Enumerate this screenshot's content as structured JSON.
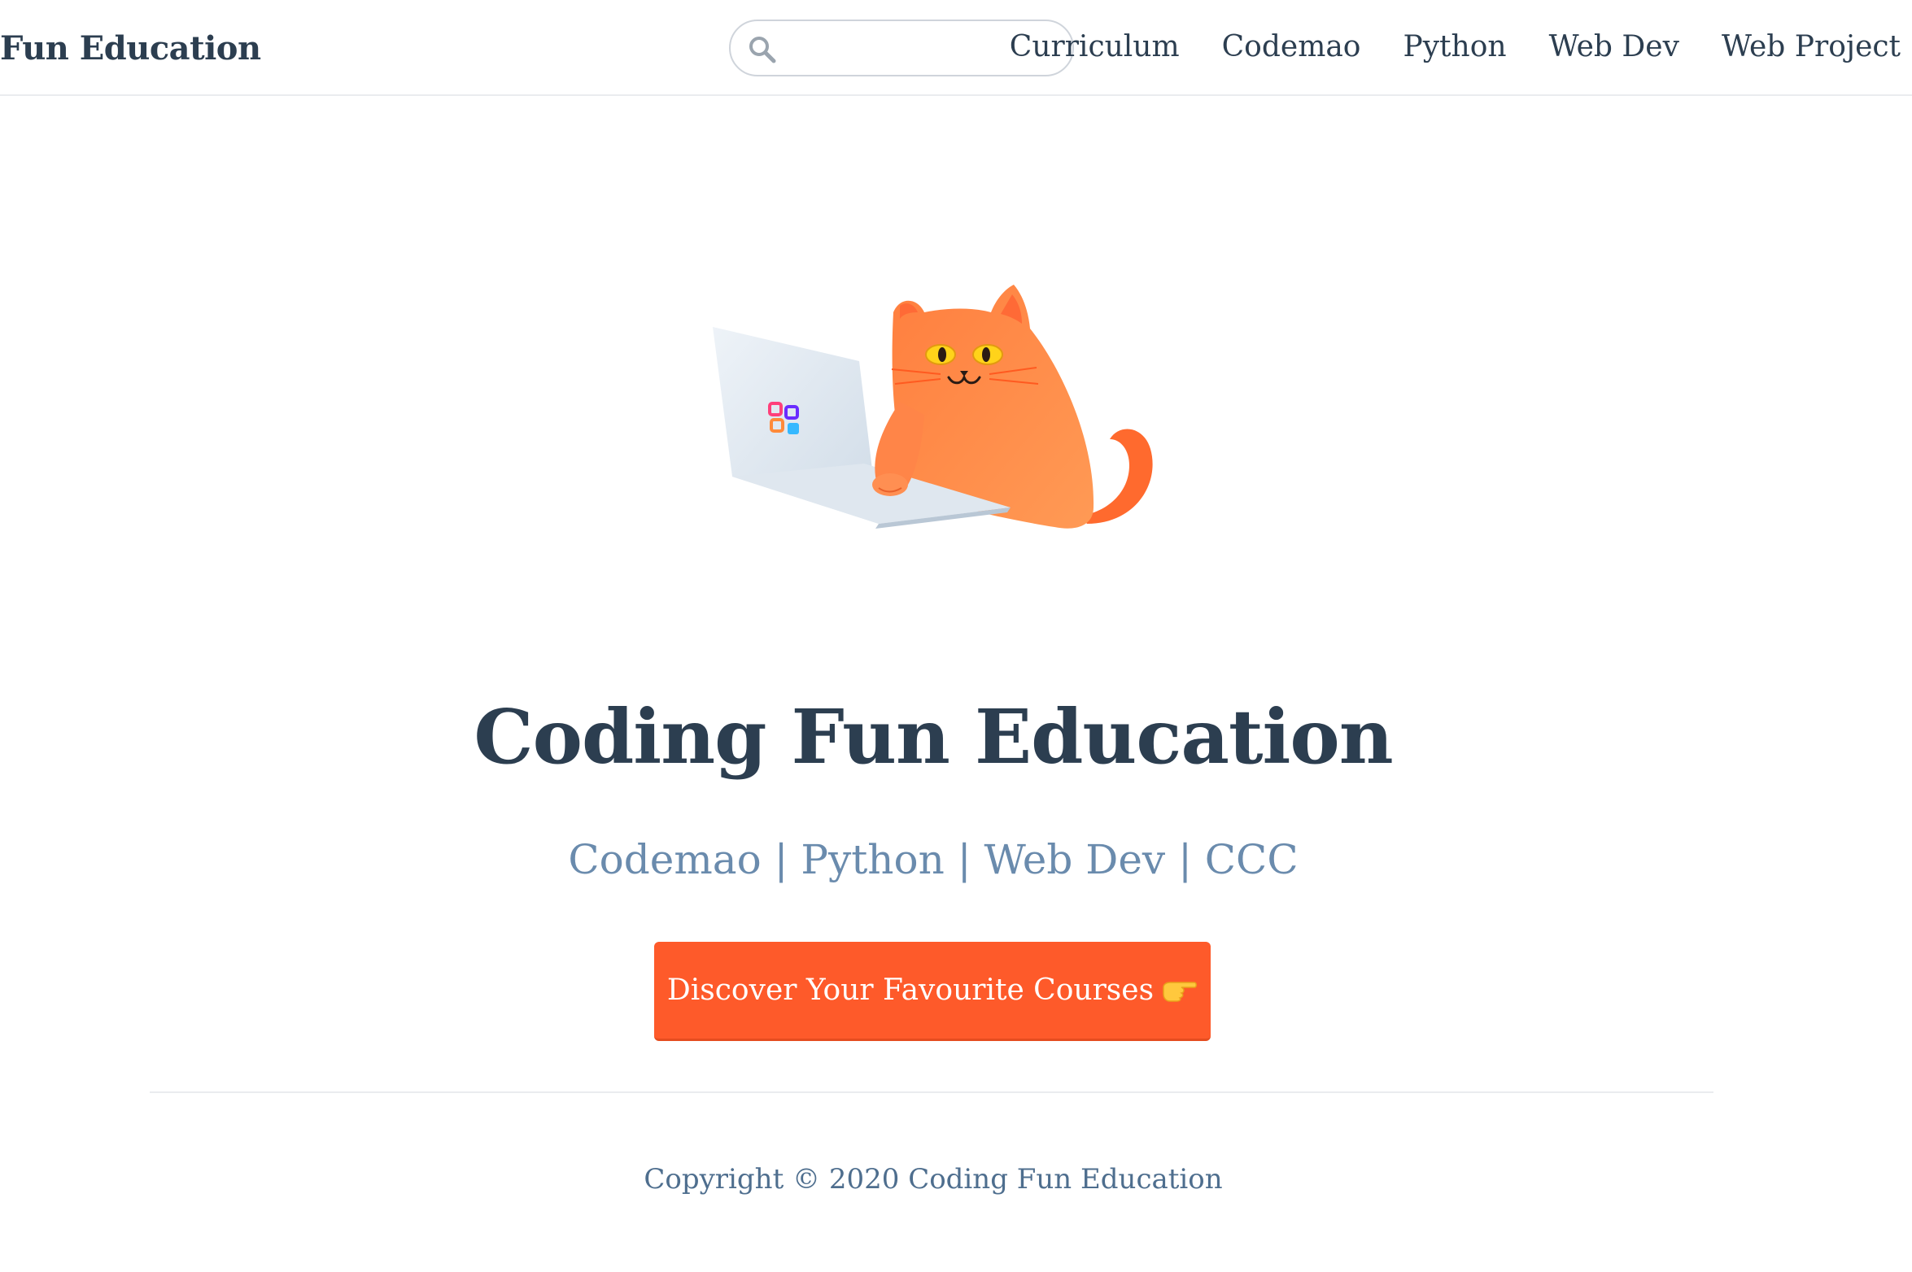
{
  "navbar": {
    "brand": "Fun Education",
    "search": {
      "placeholder": "",
      "value": ""
    },
    "links": [
      "Curriculum",
      "Codemao",
      "Python",
      "Web Dev",
      "Web Project"
    ]
  },
  "hero": {
    "title": "Coding Fun Education",
    "description": "Codemao | Python | Web Dev | CCC",
    "action_text": "Discover Your Favourite Courses",
    "action_icon": "pointing-hand-icon"
  },
  "footer": {
    "copyright": "Copyright © 2020 Coding Fun Education"
  },
  "colors": {
    "accent": "#fe5a2a",
    "text": "#2c3e50",
    "subtext": "#6a8bad",
    "cat": "#ff8a4c"
  }
}
